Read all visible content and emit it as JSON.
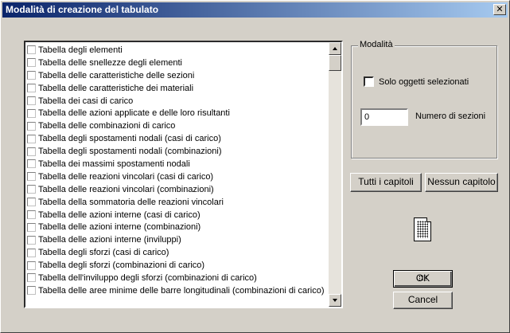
{
  "window": {
    "title": "Modalità di creazione del tabulato",
    "close_glyph": "✕"
  },
  "list": {
    "items": [
      "Tabella degli elementi",
      "Tabella delle snellezze degli elementi",
      "Tabella delle caratteristiche delle sezioni",
      "Tabella delle caratteristiche dei materiali",
      "Tabella dei casi di carico",
      "Tabella delle azioni applicate e delle loro risultanti",
      "Tabella delle combinazioni di carico",
      "Tabella degli spostamenti nodali (casi di carico)",
      "Tabella degli spostamenti nodali (combinazioni)",
      "Tabella dei massimi spostamenti nodali",
      "Tabella delle reazioni vincolari (casi di carico)",
      "Tabella delle reazioni vincolari (combinazioni)",
      "Tabella della sommatoria delle reazioni vincolari",
      "Tabella delle azioni interne (casi di carico)",
      "Tabella delle azioni interne (combinazioni)",
      "Tabella delle azioni interne (inviluppi)",
      "Tabella degli sforzi (casi di carico)",
      "Tabella degli sforzi (combinazioni di carico)",
      "Tabella dell'inviluppo degli sforzi (combinazioni di carico)",
      "Tabella delle aree minime delle barre longitudinali (combinazioni di carico)"
    ]
  },
  "modalita": {
    "group_title": "Modalità",
    "solo_selezionati_label": "Solo oggetti selezionati",
    "num_sezioni_value": "0",
    "num_sezioni_label": "Numero di sezioni"
  },
  "buttons": {
    "tutti": "Tutti i capitoli",
    "nessun": "Nessun capitolo",
    "ok": "OK",
    "cancel": "Cancel"
  },
  "icons": {
    "doc": "document-icon"
  }
}
